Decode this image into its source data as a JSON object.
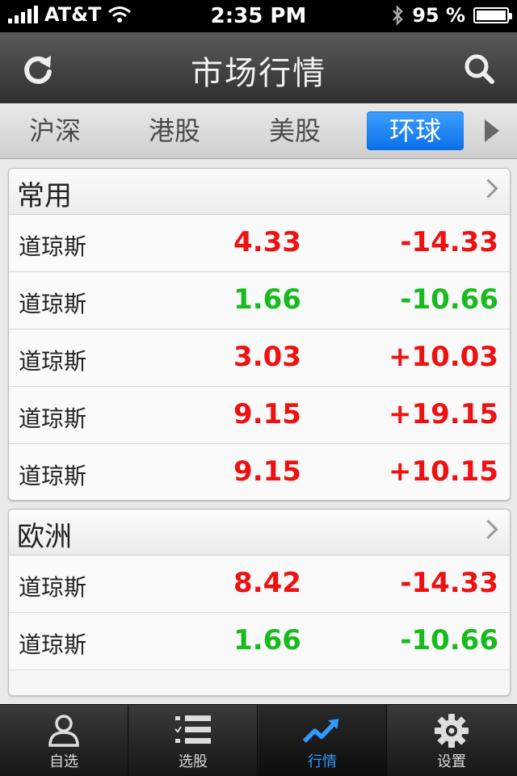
{
  "status_bar": {
    "carrier": "AT&T",
    "time": "2:35 PM",
    "battery": "95 %"
  },
  "header": {
    "title": "市场行情"
  },
  "market_tabs": [
    {
      "label": "沪深"
    },
    {
      "label": "港股"
    },
    {
      "label": "美股"
    },
    {
      "label": "环球",
      "active": true
    }
  ],
  "sections": [
    {
      "title": "常用",
      "rows": [
        {
          "name": "道琼斯",
          "price": "4.33",
          "change": "-14.33",
          "trend": "up"
        },
        {
          "name": "道琼斯",
          "price": "1.66",
          "change": "-10.66",
          "trend": "down"
        },
        {
          "name": "道琼斯",
          "price": "3.03",
          "change": "+10.03",
          "trend": "up"
        },
        {
          "name": "道琼斯",
          "price": "9.15",
          "change": "+19.15",
          "trend": "up"
        },
        {
          "name": "道琼斯",
          "price": "9.15",
          "change": "+10.15",
          "trend": "up"
        }
      ]
    },
    {
      "title": "欧洲",
      "rows": [
        {
          "name": "道琼斯",
          "price": "8.42",
          "change": "-14.33",
          "trend": "up"
        },
        {
          "name": "道琼斯",
          "price": "1.66",
          "change": "-10.66",
          "trend": "down"
        }
      ]
    }
  ],
  "tab_bar": [
    {
      "label": "自选",
      "icon": "person-icon"
    },
    {
      "label": "选股",
      "icon": "checklist-icon"
    },
    {
      "label": "行情",
      "icon": "trend-chart-icon",
      "active": true
    },
    {
      "label": "设置",
      "icon": "gear-icon"
    }
  ],
  "colors": {
    "up": "#ee1111",
    "down": "#17bb1d",
    "accent": "#0a70e8"
  }
}
